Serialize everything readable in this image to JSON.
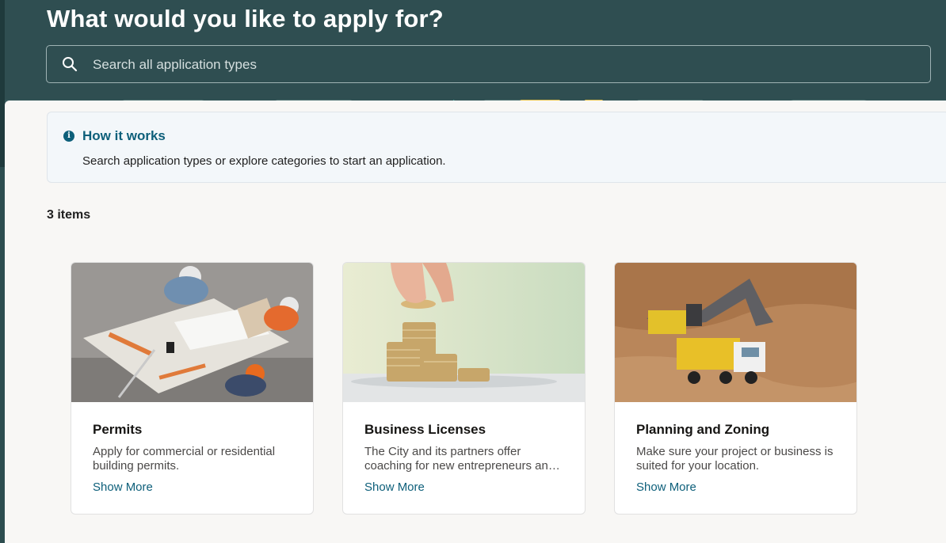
{
  "header": {
    "title": "What would you like to apply for?",
    "search_placeholder": "Search all application types"
  },
  "info": {
    "title": "How it works",
    "text": "Search application types or explore categories to start an application."
  },
  "results": {
    "count_label": "3 items"
  },
  "cards": [
    {
      "title": "Permits",
      "description": "Apply for commercial or residential building permits.",
      "link": "Show More"
    },
    {
      "title": "Business Licenses",
      "description": "The City and its partners offer coaching for new entrepreneurs and small businesses.",
      "link": "Show More"
    },
    {
      "title": "Planning and Zoning",
      "description": "Make sure your project or business is suited for your location.",
      "link": "Show More"
    }
  ],
  "colors": {
    "hero_bg": "#2f4e51",
    "accent": "#0d5f7a",
    "pattern_yellow": "#e8c34a",
    "pattern_teal": "#4fb3a8"
  }
}
